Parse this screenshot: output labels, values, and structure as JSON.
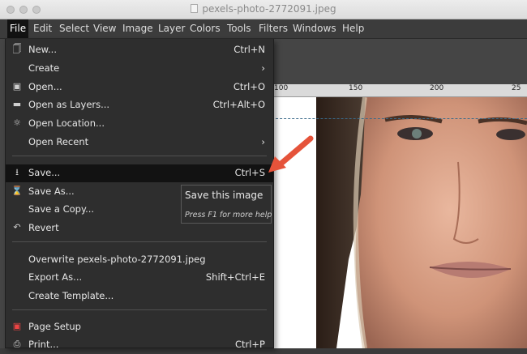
{
  "window": {
    "title": "pexels-photo-2772091.jpeg"
  },
  "menubar": {
    "items": [
      "File",
      "Edit",
      "Select",
      "View",
      "Image",
      "Layer",
      "Colors",
      "Tools",
      "Filters",
      "Windows",
      "Help"
    ]
  },
  "ruler": {
    "labels": [
      "100",
      "150",
      "200",
      "25"
    ]
  },
  "file_menu": {
    "items": [
      {
        "label": "New...",
        "shortcut": "Ctrl+N",
        "icon": "new-document-icon"
      },
      {
        "label": "Create",
        "submenu": true
      },
      {
        "label": "Open...",
        "shortcut": "Ctrl+O",
        "icon": "open-image-icon"
      },
      {
        "label": "Open as Layers...",
        "shortcut": "Ctrl+Alt+O",
        "icon": "layers-icon"
      },
      {
        "label": "Open Location...",
        "icon": "globe-icon"
      },
      {
        "label": "Open Recent",
        "submenu": true
      },
      {
        "label": "Save...",
        "shortcut": "Ctrl+S",
        "icon": "save-icon",
        "highlighted": true
      },
      {
        "label": "Save As...",
        "icon": "save-as-icon"
      },
      {
        "label": "Save a Copy..."
      },
      {
        "label": "Revert",
        "icon": "revert-icon"
      },
      {
        "label": "Overwrite pexels-photo-2772091.jpeg"
      },
      {
        "label": "Export As...",
        "shortcut": "Shift+Ctrl+E"
      },
      {
        "label": "Create Template..."
      },
      {
        "label": "Page Setup",
        "icon": "page-setup-icon"
      },
      {
        "label": "Print...",
        "shortcut": "Ctrl+P",
        "icon": "print-icon"
      }
    ]
  },
  "tooltip": {
    "title": "Save this image",
    "hint": "Press F1 for more help"
  },
  "colors": {
    "accent_arrow": "#e5533a",
    "menu_bg": "#2e2e2e",
    "highlight": "#121212"
  }
}
